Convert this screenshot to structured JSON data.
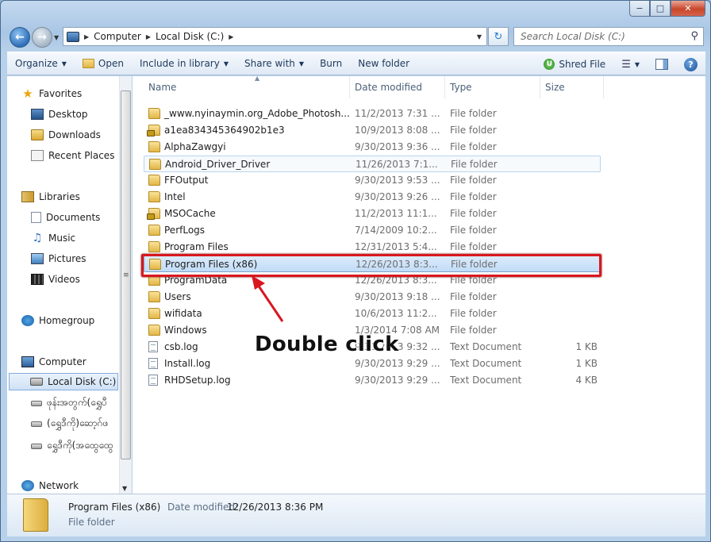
{
  "window": {
    "min": "−",
    "max": "□",
    "close": "✕"
  },
  "address": {
    "crumbs": [
      "Computer",
      "Local Disk (C:)"
    ],
    "search_placeholder": "Search Local Disk (C:)"
  },
  "toolbar": {
    "organize": "Organize",
    "open": "Open",
    "include": "Include in library",
    "share": "Share with",
    "burn": "Burn",
    "new_folder": "New folder",
    "shred": "Shred File"
  },
  "nav": {
    "favorites": "Favorites",
    "desktop": "Desktop",
    "downloads": "Downloads",
    "recent": "Recent Places",
    "libraries": "Libraries",
    "documents": "Documents",
    "music": "Music",
    "pictures": "Pictures",
    "videos": "Videos",
    "homegroup": "Homegroup",
    "computer": "Computer",
    "local_disk": "Local Disk (C:)",
    "drive1": "ဖုန်းအတွက်(ရွှေပီ",
    "drive2": "(ရွှေဒီကို)ဆော့ဂ်ဖ",
    "drive3": "ရွှေဒီကို(အထွေထွေ",
    "network": "Network"
  },
  "columns": {
    "name": "Name",
    "date": "Date modified",
    "type": "Type",
    "size": "Size"
  },
  "files": [
    {
      "name": "_www.nyinaymin.org_Adobe_Photosh...",
      "date": "11/2/2013 7:31 ...",
      "type": "File folder",
      "size": ""
    },
    {
      "name": "a1ea834345364902b1e3",
      "date": "10/9/2013 8:08 ...",
      "type": "File folder",
      "size": ""
    },
    {
      "name": "AlphaZawgyi",
      "date": "9/30/2013 9:36 ...",
      "type": "File folder",
      "size": ""
    },
    {
      "name": "Android_Driver_Driver",
      "date": "11/26/2013 7:1...",
      "type": "File folder",
      "size": ""
    },
    {
      "name": "FFOutput",
      "date": "9/30/2013 9:53 ...",
      "type": "File folder",
      "size": ""
    },
    {
      "name": "Intel",
      "date": "9/30/2013 9:26 ...",
      "type": "File folder",
      "size": ""
    },
    {
      "name": "MSOCache",
      "date": "11/2/2013 11:1...",
      "type": "File folder",
      "size": ""
    },
    {
      "name": "PerfLogs",
      "date": "7/14/2009 10:2...",
      "type": "File folder",
      "size": ""
    },
    {
      "name": "Program Files",
      "date": "12/31/2013 5:4...",
      "type": "File folder",
      "size": ""
    },
    {
      "name": "Program Files (x86)",
      "date": "12/26/2013 8:3...",
      "type": "File folder",
      "size": ""
    },
    {
      "name": "ProgramData",
      "date": "12/26/2013 8:3...",
      "type": "File folder",
      "size": ""
    },
    {
      "name": "Users",
      "date": "9/30/2013 9:18 ...",
      "type": "File folder",
      "size": ""
    },
    {
      "name": "wifidata",
      "date": "10/6/2013 11:2...",
      "type": "File folder",
      "size": ""
    },
    {
      "name": "Windows",
      "date": "1/3/2014 7:08 AM",
      "type": "File folder",
      "size": ""
    },
    {
      "name": "csb.log",
      "date": "9/30/2013 9:32 ...",
      "type": "Text Document",
      "size": "1 KB"
    },
    {
      "name": "Install.log",
      "date": "9/30/2013 9:29 ...",
      "type": "Text Document",
      "size": "1 KB"
    },
    {
      "name": "RHDSetup.log",
      "date": "9/30/2013 9:29 ...",
      "type": "Text Document",
      "size": "4 KB"
    }
  ],
  "annotation": {
    "label": "Double click",
    "color": "#d8171f"
  },
  "details": {
    "name": "Program Files (x86)",
    "date_label": "Date modified:",
    "date": "12/26/2013 8:36 PM",
    "type": "File folder"
  }
}
